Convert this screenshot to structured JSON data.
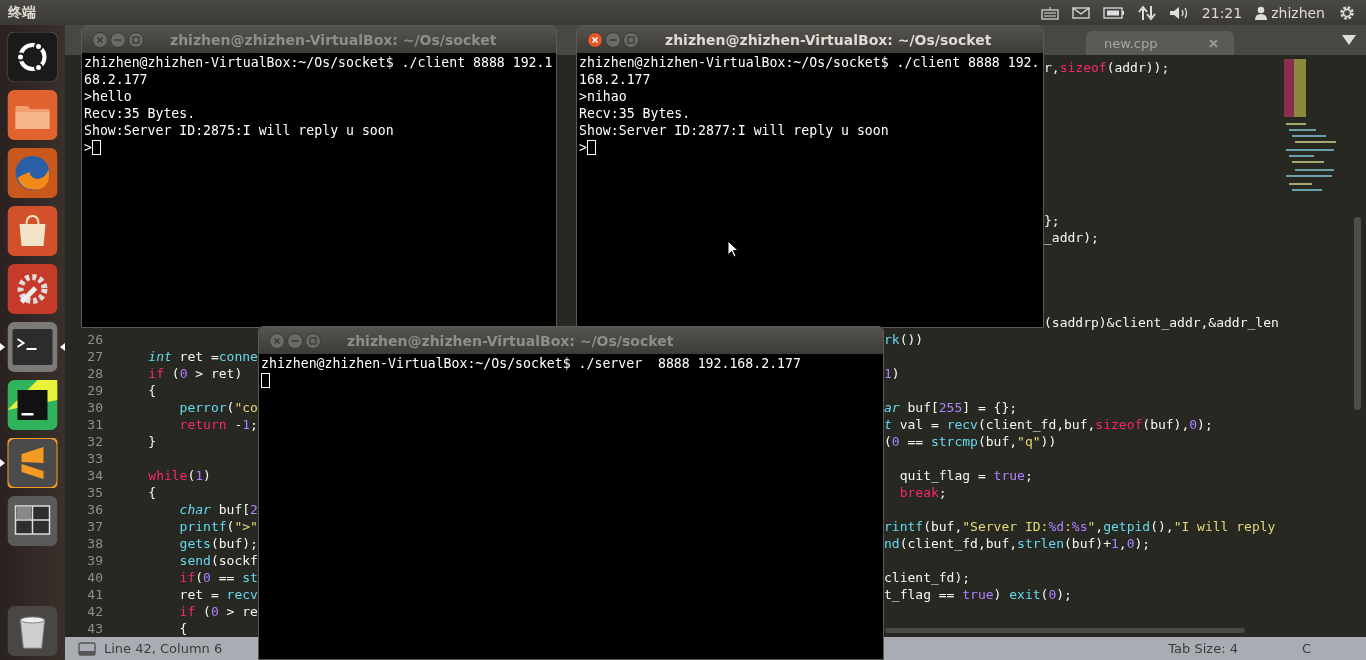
{
  "top_panel": {
    "app_title": "终端",
    "clock": "21:21",
    "user": "zhizhen"
  },
  "launcher": [
    {
      "kind": "dash",
      "running": false,
      "focused": false
    },
    {
      "kind": "files",
      "running": false,
      "focused": false
    },
    {
      "kind": "browser",
      "running": false,
      "focused": false
    },
    {
      "kind": "store",
      "running": false,
      "focused": false
    },
    {
      "kind": "settings",
      "running": false,
      "focused": false
    },
    {
      "kind": "terminal",
      "running": true,
      "focused": true
    },
    {
      "kind": "ide",
      "running": false,
      "focused": false
    },
    {
      "kind": "editor",
      "running": true,
      "focused": false
    },
    {
      "kind": "workspaces",
      "running": false,
      "focused": false
    },
    {
      "kind": "trash",
      "running": false,
      "focused": false
    }
  ],
  "editor": {
    "tabs": [
      {
        "label": "new.cpp",
        "selected": false
      }
    ],
    "rows": [
      {
        "right": [
          {
            "text": "r,",
            "kind": "plain"
          },
          {
            "text": "sizeof",
            "kind": "keyword"
          },
          {
            "text": "(addr));",
            "kind": "plain"
          }
        ]
      },
      {},
      {},
      {},
      {},
      {},
      {},
      {},
      {},
      {
        "right": [
          {
            "text": "};",
            "kind": "plain"
          }
        ]
      },
      {
        "right": [
          {
            "text": "_addr);",
            "kind": "plain"
          }
        ]
      },
      {},
      {},
      {},
      {},
      {
        "right": [
          {
            "text": "(saddrp)&client_addr,&addr_len",
            "kind": "plain"
          }
        ]
      },
      {
        "number": "26",
        "right": [
          {
            "text": "rk",
            "kind": "func"
          },
          {
            "text": "())",
            "kind": "plain"
          }
        ]
      },
      {
        "number": "27",
        "left": [
          {
            "text": "    int",
            "kind": "type"
          },
          {
            "text": " ret =",
            "kind": "plain"
          },
          {
            "text": "conne",
            "kind": "func"
          }
        ]
      },
      {
        "number": "28",
        "left": [
          {
            "text": "    if",
            "kind": "keyword"
          },
          {
            "text": " (",
            "kind": "plain"
          },
          {
            "text": "0",
            "kind": "number"
          },
          {
            "text": " > ret)",
            "kind": "plain"
          }
        ],
        "right": [
          {
            "text": "1",
            "kind": "number"
          },
          {
            "text": ")",
            "kind": "plain"
          }
        ]
      },
      {
        "number": "29",
        "left": [
          {
            "text": "    {",
            "kind": "plain"
          }
        ]
      },
      {
        "number": "30",
        "left": [
          {
            "text": "        perror",
            "kind": "func"
          },
          {
            "text": "(",
            "kind": "plain"
          },
          {
            "text": "\"co",
            "kind": "string"
          }
        ],
        "right": [
          {
            "text": "ar",
            "kind": "type"
          },
          {
            "text": " buf[",
            "kind": "plain"
          },
          {
            "text": "255",
            "kind": "number"
          },
          {
            "text": "] = {};",
            "kind": "plain"
          }
        ]
      },
      {
        "number": "31",
        "left": [
          {
            "text": "        return",
            "kind": "keyword"
          },
          {
            "text": " -",
            "kind": "plain"
          },
          {
            "text": "1",
            "kind": "number"
          },
          {
            "text": ";",
            "kind": "plain"
          }
        ],
        "right": [
          {
            "text": "t",
            "kind": "type"
          },
          {
            "text": " val = ",
            "kind": "plain"
          },
          {
            "text": "recv",
            "kind": "func"
          },
          {
            "text": "(client_fd,buf,",
            "kind": "plain"
          },
          {
            "text": "sizeof",
            "kind": "keyword"
          },
          {
            "text": "(buf),",
            "kind": "plain"
          },
          {
            "text": "0",
            "kind": "number"
          },
          {
            "text": ");",
            "kind": "plain"
          }
        ]
      },
      {
        "number": "32",
        "left": [
          {
            "text": "    }",
            "kind": "plain"
          }
        ],
        "right": [
          {
            "text": "(",
            "kind": "plain"
          },
          {
            "text": "0",
            "kind": "number"
          },
          {
            "text": " == ",
            "kind": "plain"
          },
          {
            "text": "strcmp",
            "kind": "func"
          },
          {
            "text": "(buf,",
            "kind": "plain"
          },
          {
            "text": "\"q\"",
            "kind": "string"
          },
          {
            "text": "))",
            "kind": "plain"
          }
        ]
      },
      {
        "number": "33"
      },
      {
        "number": "34",
        "left": [
          {
            "text": "    while",
            "kind": "keyword"
          },
          {
            "text": "(",
            "kind": "plain"
          },
          {
            "text": "1",
            "kind": "number"
          },
          {
            "text": ")",
            "kind": "plain"
          }
        ],
        "right": [
          {
            "text": "  quit_flag = ",
            "kind": "plain"
          },
          {
            "text": "true",
            "kind": "number"
          },
          {
            "text": ";",
            "kind": "plain"
          }
        ]
      },
      {
        "number": "35",
        "left": [
          {
            "text": "    {",
            "kind": "plain"
          }
        ],
        "right": [
          {
            "text": "  break",
            "kind": "keyword"
          },
          {
            "text": ";",
            "kind": "plain"
          }
        ]
      },
      {
        "number": "36",
        "left": [
          {
            "text": "        char",
            "kind": "type"
          },
          {
            "text": " buf[",
            "kind": "plain"
          },
          {
            "text": "2",
            "kind": "number"
          }
        ]
      },
      {
        "number": "37",
        "left": [
          {
            "text": "        printf",
            "kind": "func"
          },
          {
            "text": "(",
            "kind": "plain"
          },
          {
            "text": "\">\"",
            "kind": "string"
          }
        ],
        "right": [
          {
            "text": "rintf",
            "kind": "func"
          },
          {
            "text": "(buf,",
            "kind": "plain"
          },
          {
            "text": "\"Server ID:",
            "kind": "string"
          },
          {
            "text": "%d",
            "kind": "number"
          },
          {
            "text": ":",
            "kind": "string"
          },
          {
            "text": "%s",
            "kind": "number"
          },
          {
            "text": "\"",
            "kind": "string"
          },
          {
            "text": ",",
            "kind": "plain"
          },
          {
            "text": "getpid",
            "kind": "func"
          },
          {
            "text": "(),",
            "kind": "plain"
          },
          {
            "text": "\"I will reply",
            "kind": "string"
          }
        ]
      },
      {
        "number": "38",
        "left": [
          {
            "text": "        gets",
            "kind": "func"
          },
          {
            "text": "(buf);",
            "kind": "plain"
          }
        ],
        "right": [
          {
            "text": "nd",
            "kind": "func"
          },
          {
            "text": "(client_fd,buf,",
            "kind": "plain"
          },
          {
            "text": "strlen",
            "kind": "func"
          },
          {
            "text": "(buf)+",
            "kind": "plain"
          },
          {
            "text": "1",
            "kind": "number"
          },
          {
            "text": ",",
            "kind": "plain"
          },
          {
            "text": "0",
            "kind": "number"
          },
          {
            "text": ");",
            "kind": "plain"
          }
        ]
      },
      {
        "number": "39",
        "left": [
          {
            "text": "        send",
            "kind": "func"
          },
          {
            "text": "(sockf",
            "kind": "plain"
          }
        ]
      },
      {
        "number": "40",
        "left": [
          {
            "text": "        if",
            "kind": "keyword"
          },
          {
            "text": "(",
            "kind": "plain"
          },
          {
            "text": "0",
            "kind": "number"
          },
          {
            "text": " == ",
            "kind": "plain"
          },
          {
            "text": "st",
            "kind": "func"
          }
        ],
        "right": [
          {
            "text": "client_fd);",
            "kind": "plain"
          }
        ]
      },
      {
        "number": "41",
        "left": [
          {
            "text": "        ret = ",
            "kind": "plain"
          },
          {
            "text": "recv",
            "kind": "func"
          }
        ],
        "right": [
          {
            "text": "t_flag == ",
            "kind": "plain"
          },
          {
            "text": "true",
            "kind": "number"
          },
          {
            "text": ") ",
            "kind": "plain"
          },
          {
            "text": "exit",
            "kind": "func"
          },
          {
            "text": "(",
            "kind": "plain"
          },
          {
            "text": "0",
            "kind": "number"
          },
          {
            "text": ");",
            "kind": "plain"
          }
        ]
      },
      {
        "number": "42",
        "left": [
          {
            "text": "        if",
            "kind": "keyword"
          },
          {
            "text": " (",
            "kind": "plain"
          },
          {
            "text": "0",
            "kind": "number"
          },
          {
            "text": " > re",
            "kind": "plain"
          }
        ]
      },
      {
        "number": "43",
        "left": [
          {
            "text": "        {",
            "kind": "plain"
          }
        ]
      }
    ],
    "status_bar": {
      "position": "Line 42, Column 6",
      "tab_size": "Tab Size: 4",
      "syntax": "C"
    }
  },
  "terminals": [
    {
      "title": "zhizhen@zhizhen-VirtualBox: ~/Os/socket",
      "focused": false,
      "lines": [
        "zhizhen@zhizhen-VirtualBox:~/Os/socket$ ./client 8888 192.1",
        "68.2.177",
        ">hello",
        "Recv:35 Bytes.",
        "Show:Server ID:2875:I will reply u soon"
      ],
      "prompt": ">"
    },
    {
      "title": "zhizhen@zhizhen-VirtualBox: ~/Os/socket",
      "focused": true,
      "lines": [
        "zhizhen@zhizhen-VirtualBox:~/Os/socket$ ./client 8888 192.",
        "168.2.177",
        ">nihao",
        "Recv:35 Bytes.",
        "Show:Server ID:2877:I will reply u soon"
      ],
      "prompt": ">"
    },
    {
      "title": "zhizhen@zhizhen-VirtualBox: ~/Os/socket",
      "focused": false,
      "lines": [
        "zhizhen@zhizhen-VirtualBox:~/Os/socket$ ./server  8888 192.168.2.177"
      ]
    }
  ]
}
